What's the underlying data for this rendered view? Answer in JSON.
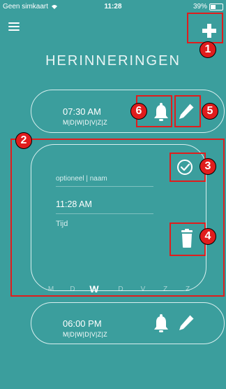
{
  "status_bar": {
    "carrier": "Geen simkaart",
    "time": "11:28",
    "battery": "39%",
    "battery_level": 0.39
  },
  "header": {
    "title": "HERINNERINGEN",
    "menu_icon": "hamburger-menu-icon",
    "add_icon": "plus-icon"
  },
  "reminders": [
    {
      "time": "07:30 AM",
      "days": "M|D|W|D|V|Z|Z"
    },
    {
      "time": "06:00 PM",
      "days": "M|D|W|D|V|Z|Z"
    }
  ],
  "edit_card": {
    "name_placeholder": "optioneel | naam",
    "time_value": "11:28 AM",
    "time_label": "Tijd",
    "days": [
      "M",
      "D",
      "W",
      "D",
      "V",
      "Z",
      "Z"
    ],
    "selected_day": "W"
  },
  "annotations": [
    "1",
    "2",
    "3",
    "4",
    "5",
    "6"
  ],
  "colors": {
    "background": "#3b9e9d",
    "annotation": "#e01d1d",
    "text": "#ffffff"
  }
}
